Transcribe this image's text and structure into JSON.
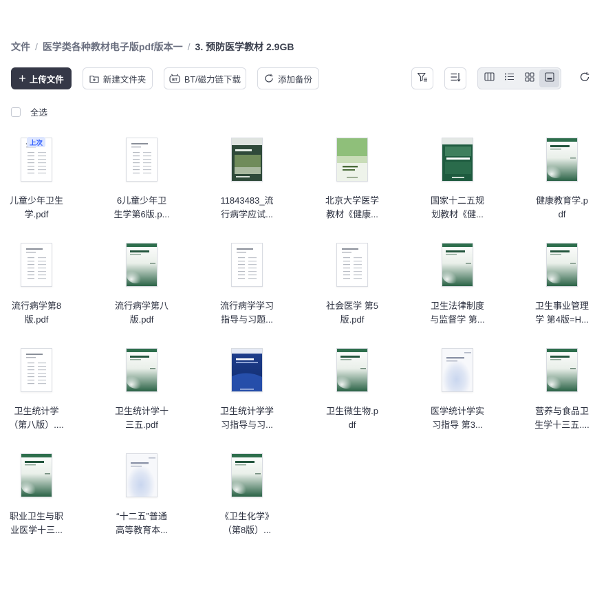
{
  "breadcrumb": {
    "root": "文件",
    "level1": "医学类各种教材电子版pdf版本一",
    "current": "3. 预防医学教材 2.9GB"
  },
  "toolbar": {
    "upload_label": "上传文件",
    "new_folder_label": "新建文件夹",
    "bt_download_label": "BT/磁力链下载",
    "add_backup_label": "添加备份"
  },
  "select_all_label": "全选",
  "files": [
    {
      "line1": "儿童少年卫生",
      "line2": "学.pdf",
      "badge": "上次",
      "cover": "doc"
    },
    {
      "line1": "6儿童少年卫",
      "line2": "生学第6版.p...",
      "cover": "doc"
    },
    {
      "line1": "11843483_流",
      "line2": "行病学应试...",
      "cover": "dark"
    },
    {
      "line1": "北京大学医学",
      "line2": "教材《健康...",
      "cover": "light"
    },
    {
      "line1": "国家十二五规",
      "line2": "划教材《健...",
      "cover": "dark2"
    },
    {
      "line1": "健康教育学.p",
      "line2": "df",
      "cover": "green"
    },
    {
      "line1": "流行病学第8",
      "line2": "版.pdf",
      "cover": "doc"
    },
    {
      "line1": "流行病学第八",
      "line2": "版.pdf",
      "cover": "green"
    },
    {
      "line1": "流行病学学习",
      "line2": "指导与习题...",
      "cover": "doc"
    },
    {
      "line1": "社会医学 第5",
      "line2": "版.pdf",
      "cover": "doc"
    },
    {
      "line1": "卫生法律制度",
      "line2": "与监督学 第...",
      "cover": "green"
    },
    {
      "line1": "卫生事业管理",
      "line2": "学 第4版=H...",
      "cover": "green"
    },
    {
      "line1": "卫生统计学",
      "line2": "（第八版）....",
      "cover": "doc"
    },
    {
      "line1": "卫生统计学十",
      "line2": "三五.pdf",
      "cover": "green"
    },
    {
      "line1": "卫生统计学学",
      "line2": "习指导与习...",
      "cover": "blue"
    },
    {
      "line1": "卫生微生物.p",
      "line2": "df",
      "cover": "green"
    },
    {
      "line1": "医学统计学实",
      "line2": "习指导 第3...",
      "cover": "soft"
    },
    {
      "line1": "营养与食品卫",
      "line2": "生学十三五....",
      "cover": "green"
    },
    {
      "line1": "职业卫生与职",
      "line2": "业医学十三...",
      "cover": "green"
    },
    {
      "line1": "“十二五”普通",
      "line2": "高等教育本...",
      "cover": "soft"
    },
    {
      "line1": "《卫生化学》",
      "line2": "（第8版）...",
      "cover": "green"
    }
  ]
}
